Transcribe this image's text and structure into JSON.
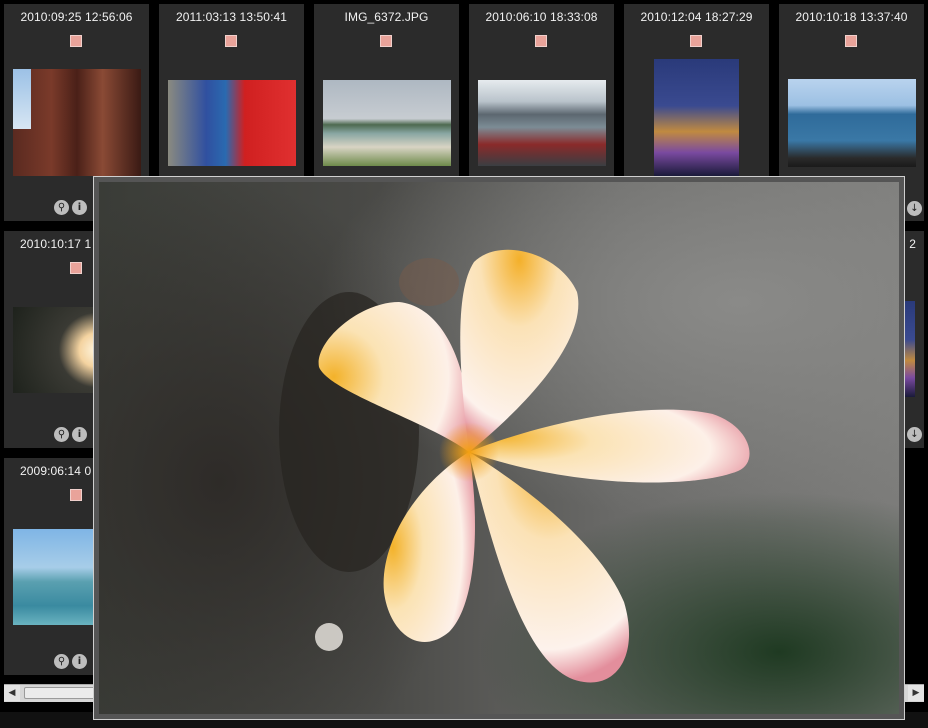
{
  "tiles": [
    {
      "timestamp": "2010:09:25 12:56:06",
      "thumb": "city-building"
    },
    {
      "timestamp": "2011:03:13 13:50:41",
      "thumb": "street-shop"
    },
    {
      "timestamp": "IMG_6372.JPG",
      "thumb": "beach"
    },
    {
      "timestamp": "2010:06:10 18:33:08",
      "thumb": "harbor-houses"
    },
    {
      "timestamp": "2010:12:04 18:27:29",
      "thumb": "night-church"
    },
    {
      "timestamp": "2010:10:18 13:37:40",
      "thumb": "boat-sea"
    },
    {
      "timestamp": "2010:10:17 1",
      "thumb": "flower"
    },
    {
      "timestamp": "2009:06:14 0",
      "thumb": "sea"
    }
  ],
  "partial_right_text": "2",
  "icons": {
    "zoom": "magnifier-icon",
    "info": "info-icon",
    "download": "download-icon"
  },
  "preview": {
    "subject": "plumeria-flower"
  },
  "colors": {
    "tile_bg": "#2b2b2b",
    "checkbox": "#e9a39a",
    "page_bg": "#000000"
  }
}
